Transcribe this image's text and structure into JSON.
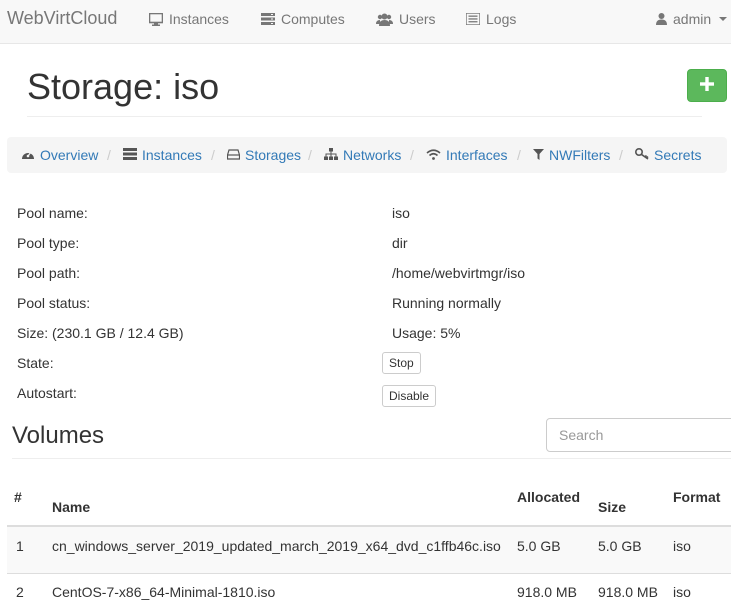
{
  "navbar": {
    "brand": "WebVirtCloud",
    "items": [
      {
        "label": "Instances",
        "icon": "desktop-icon"
      },
      {
        "label": "Computes",
        "icon": "server-icon"
      },
      {
        "label": "Users",
        "icon": "users-icon"
      },
      {
        "label": "Logs",
        "icon": "list-icon"
      }
    ],
    "user": {
      "label": "admin",
      "icon": "user-icon"
    }
  },
  "page": {
    "title": "Storage: iso",
    "add_button_icon": "plus-icon",
    "add_button_color": "#5cb85c"
  },
  "breadcrumb": {
    "items": [
      {
        "label": "Overview",
        "icon": "dashboard-icon"
      },
      {
        "label": "Instances",
        "icon": "server-icon"
      },
      {
        "label": "Storages",
        "icon": "hdd-icon"
      },
      {
        "label": "Networks",
        "icon": "sitemap-icon"
      },
      {
        "label": "Interfaces",
        "icon": "wifi-icon"
      },
      {
        "label": "NWFilters",
        "icon": "filter-icon"
      },
      {
        "label": "Secrets",
        "icon": "key-icon"
      }
    ],
    "separator": "/"
  },
  "details": {
    "pool_name_label": "Pool name:",
    "pool_name": "iso",
    "pool_type_label": "Pool type:",
    "pool_type": "dir",
    "pool_path_label": "Pool path:",
    "pool_path": "/home/webvirtmgr/iso",
    "pool_status_label": "Pool status:",
    "pool_status": "Running normally",
    "size_label": "Size: (230.1 GB / 12.4 GB)",
    "usage": "Usage: 5%",
    "state_label": "State:",
    "state_button": "Stop",
    "autostart_label": "Autostart:",
    "autostart_button": "Disable"
  },
  "volumes": {
    "title": "Volumes",
    "search_placeholder": "Search",
    "columns": {
      "num": "#",
      "name": "Name",
      "allocated": "Allocated",
      "size": "Size",
      "format": "Format"
    },
    "rows": [
      {
        "num": "1",
        "name": "cn_windows_server_2019_updated_march_2019_x64_dvd_c1ffb46c.iso",
        "allocated": "5.0 GB",
        "size": "5.0 GB",
        "format": "iso"
      },
      {
        "num": "2",
        "name": "CentOS-7-x86_64-Minimal-1810.iso",
        "allocated": "918.0 MB",
        "size": "918.0 MB",
        "format": "iso"
      }
    ]
  }
}
